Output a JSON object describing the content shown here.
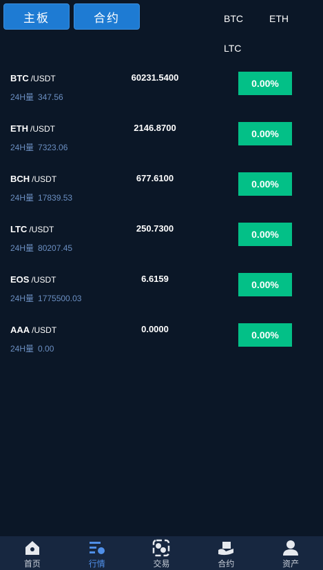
{
  "tabs": [
    "主板",
    "合约"
  ],
  "coin_filters": [
    "BTC",
    "ETH",
    "LTC"
  ],
  "vol_label": "24H量",
  "markets": [
    {
      "symbol": "BTC",
      "quote": "/USDT",
      "volume": "347.56",
      "price": "60231.5400",
      "change": "0.00%"
    },
    {
      "symbol": "ETH",
      "quote": "/USDT",
      "volume": "7323.06",
      "price": "2146.8700",
      "change": "0.00%"
    },
    {
      "symbol": "BCH",
      "quote": "/USDT",
      "volume": "17839.53",
      "price": "677.6100",
      "change": "0.00%"
    },
    {
      "symbol": "LTC",
      "quote": "/USDT",
      "volume": "80207.45",
      "price": "250.7300",
      "change": "0.00%"
    },
    {
      "symbol": "EOS",
      "quote": "/USDT",
      "volume": "1775500.03",
      "price": "6.6159",
      "change": "0.00%"
    },
    {
      "symbol": "AAA",
      "quote": "/USDT",
      "volume": "0.00",
      "price": "0.0000",
      "change": "0.00%"
    }
  ],
  "nav": [
    {
      "label": "首页",
      "icon": "home-icon"
    },
    {
      "label": "行情",
      "icon": "market-icon",
      "active": true
    },
    {
      "label": "交易",
      "icon": "trade-icon"
    },
    {
      "label": "合约",
      "icon": "contract-icon"
    },
    {
      "label": "资产",
      "icon": "user-icon"
    }
  ],
  "colors": {
    "background": "#0b1727",
    "tab": "#1e7bd3",
    "up": "#03c087",
    "nav_bg": "#172740",
    "active": "#4f8fe8"
  }
}
